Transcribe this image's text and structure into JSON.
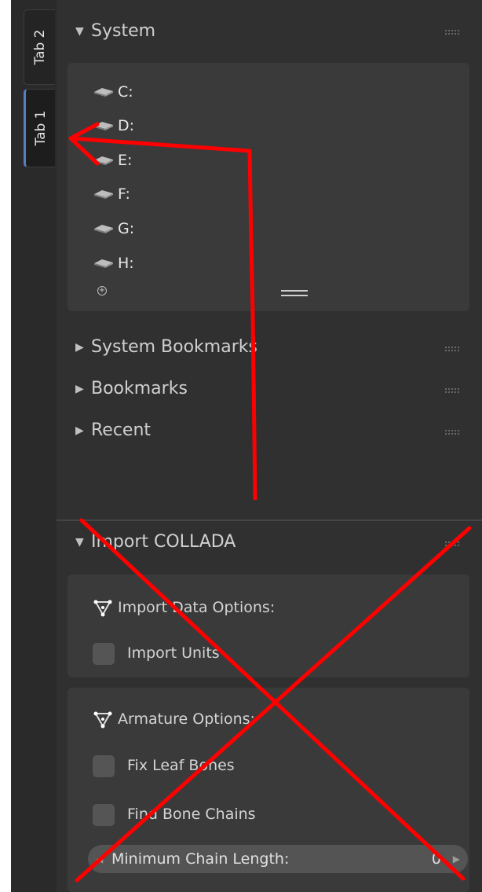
{
  "tabs": [
    {
      "label": "Tab 2",
      "active": false
    },
    {
      "label": "Tab 1",
      "active": true
    }
  ],
  "system": {
    "header": "System",
    "drives": [
      "C:",
      "D:",
      "E:",
      "F:",
      "G:",
      "H:"
    ]
  },
  "collapsed_sections": [
    "System Bookmarks",
    "Bookmarks",
    "Recent"
  ],
  "collada": {
    "header": "Import COLLADA",
    "data_options": {
      "title": "Import Data Options:",
      "checkboxes": [
        "Import Units"
      ]
    },
    "armature_options": {
      "title": "Armature Options:",
      "checkboxes": [
        "Fix Leaf Bones",
        "Find Bone Chains"
      ],
      "min_chain": {
        "label": "Minimum Chain Length:",
        "value": "0"
      }
    }
  },
  "colors": {
    "annotation": "#ff0000",
    "active_tab_accent": "#5680c2",
    "panel_bg": "#303030"
  }
}
